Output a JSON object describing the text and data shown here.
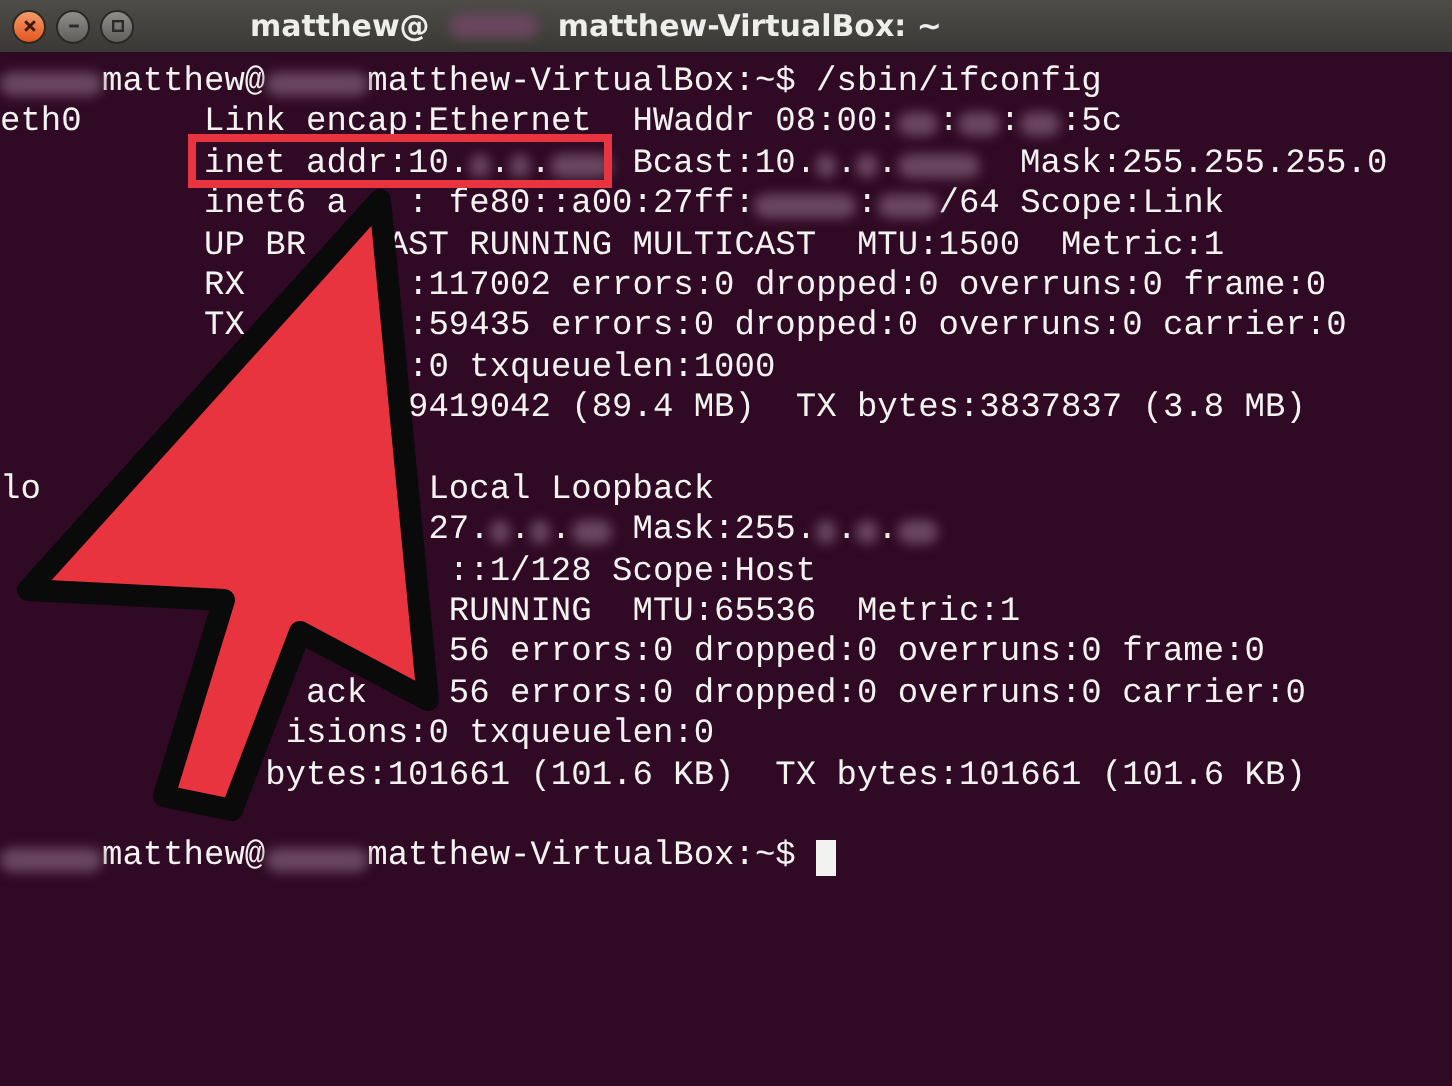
{
  "window": {
    "title_parts": [
      "matthew@",
      "matthew-VirtualBox: ~"
    ]
  },
  "terminal": {
    "lines": [
      {
        "kind": "prompt",
        "cursor": false,
        "segments": [
          "     matthew@",
          "     matthew-VirtualBox:~$ /sbin/ifconfig"
        ]
      },
      {
        "kind": "output",
        "segments": [
          "eth0",
          "      Link encap:Ethernet",
          "  HWaddr 08:00:",
          "  :",
          "  :",
          "  :5c"
        ]
      },
      {
        "kind": "output",
        "segments": [
          "          inet addr:10.",
          " .",
          " .",
          "    Bcast:10.",
          " .",
          " .",
          "      Mask:255.255.255.0"
        ]
      },
      {
        "kind": "output",
        "segments": [
          "          inet6 a",
          "   : fe80::a00:27ff:",
          "     :",
          "   /64 Scope:Link"
        ]
      },
      {
        "kind": "output",
        "segments": [
          "          UP BR",
          "    AST RUNNING MULTICAST  MTU:1500  Metric:1"
        ]
      },
      {
        "kind": "output",
        "segments": [
          "          RX",
          "        :117002 errors:0 dropped:0 overruns:0 frame:0"
        ]
      },
      {
        "kind": "output",
        "segments": [
          "          TX",
          "        :59435 errors:0 dropped:0 overruns:0 carrier:0"
        ]
      },
      {
        "kind": "output",
        "segments": [
          "                    :0 txqueuelen:1000"
        ]
      },
      {
        "kind": "output",
        "segments": [
          "                    9419042 (89.4 MB)  TX bytes:3837837 (3.8 MB)"
        ]
      },
      {
        "kind": "blank"
      },
      {
        "kind": "output",
        "segments": [
          "lo",
          "                   Local Loopback"
        ]
      },
      {
        "kind": "output",
        "segments": [
          "                     27.",
          " .",
          " .",
          "   Mask:255.",
          " .",
          " ."
        ]
      },
      {
        "kind": "output",
        "segments": [
          "                      ::1/128 Scope:Host"
        ]
      },
      {
        "kind": "output",
        "segments": [
          "                      RUNNING  MTU:65536  Metric:1"
        ]
      },
      {
        "kind": "output",
        "segments": [
          "                      56 errors:0 dropped:0 overruns:0 frame:0"
        ]
      },
      {
        "kind": "output",
        "segments": [
          "               ack",
          "    56 errors:0 dropped:0 overruns:0 carrier:0"
        ]
      },
      {
        "kind": "output",
        "segments": [
          "              isions:0 txqueuelen:0"
        ]
      },
      {
        "kind": "output",
        "segments": [
          "             bytes:101661 (101.6 KB)  TX bytes:101661 (101.6 KB)"
        ]
      },
      {
        "kind": "blank"
      },
      {
        "kind": "prompt",
        "cursor": true,
        "segments": [
          "     matthew@",
          "     matthew-VirtualBox:~$"
        ]
      }
    ]
  }
}
